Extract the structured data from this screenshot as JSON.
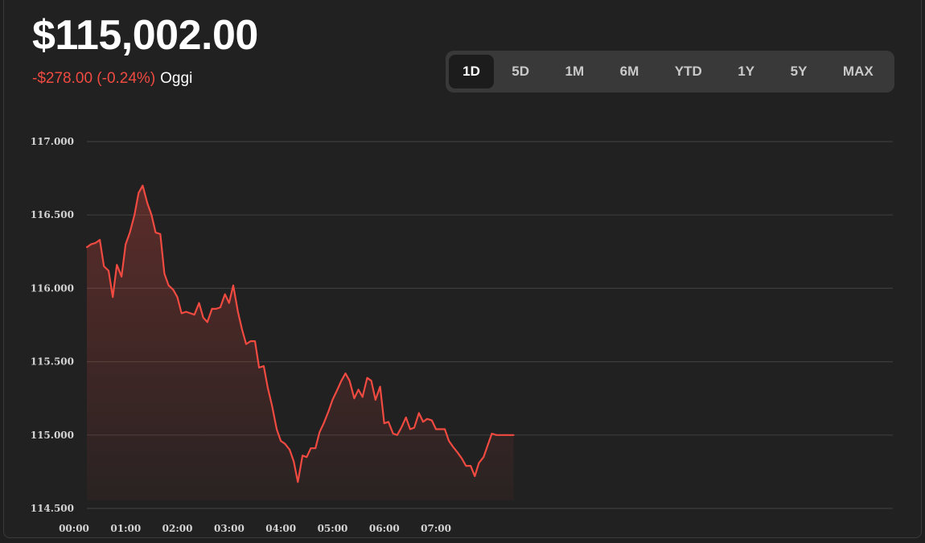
{
  "header": {
    "price": "$115,002.00",
    "change": "-$278.00 (-0.24%)",
    "period_label": "Oggi"
  },
  "range_selector": {
    "options": [
      "1D",
      "5D",
      "1M",
      "6M",
      "YTD",
      "1Y",
      "5Y",
      "MAX"
    ],
    "active": "1D"
  },
  "colors": {
    "line": "#f04a41",
    "negative_text": "#f04a41",
    "background": "#212121",
    "grid": "#3c3c3c",
    "active_tab": "#1c1c1c",
    "tab_bar": "#393939"
  },
  "chart_data": {
    "type": "area",
    "title": "",
    "xlabel": "",
    "ylabel": "",
    "x_ticks": [
      "00:00",
      "01:00",
      "02:00",
      "03:00",
      "04:00",
      "05:00",
      "06:00",
      "07:00"
    ],
    "y_ticks": [
      "117.000",
      "116.500",
      "116.000",
      "115.500",
      "115.000",
      "114.500"
    ],
    "y_tick_values": [
      117000,
      116500,
      116000,
      115500,
      115000,
      114500
    ],
    "ylim": [
      114500,
      117000
    ],
    "xlim_hours": [
      0,
      16
    ],
    "grid": true,
    "series": [
      {
        "x": [
          0.0,
          0.08,
          0.17,
          0.25,
          0.33,
          0.42,
          0.5,
          0.58,
          0.67,
          0.75,
          0.83,
          0.92,
          1.0,
          1.08,
          1.17,
          1.25,
          1.33,
          1.42,
          1.5,
          1.58,
          1.67,
          1.75,
          1.83,
          1.92,
          2.0,
          2.08,
          2.17,
          2.25,
          2.33,
          2.42,
          2.5,
          2.58,
          2.67,
          2.75,
          2.83,
          2.92,
          3.0,
          3.08,
          3.17,
          3.25,
          3.33,
          3.42,
          3.5,
          3.58,
          3.67,
          3.75,
          3.83,
          3.92,
          4.0,
          4.08,
          4.17,
          4.25,
          4.33,
          4.42,
          4.5,
          4.58,
          4.67,
          4.75,
          4.83,
          4.92,
          5.0,
          5.08,
          5.17,
          5.25,
          5.33,
          5.42,
          5.5,
          5.58,
          5.67,
          5.75,
          5.83,
          5.92,
          6.0,
          6.08,
          6.17,
          6.25,
          6.33,
          6.42,
          6.5,
          6.58,
          6.67,
          6.75,
          6.83,
          6.92,
          7.0,
          7.08,
          7.17,
          7.25,
          7.33,
          7.42,
          7.5,
          7.58,
          7.67,
          7.75,
          7.83,
          7.92,
          8.0,
          8.08,
          8.17,
          8.25
        ],
        "y": [
          116280,
          116300,
          116310,
          116330,
          116150,
          116120,
          115940,
          116160,
          116080,
          116300,
          116380,
          116500,
          116650,
          116700,
          116580,
          116500,
          116380,
          116370,
          116100,
          116020,
          115990,
          115940,
          115830,
          115840,
          115830,
          115820,
          115900,
          115800,
          115770,
          115860,
          115860,
          115870,
          115960,
          115900,
          116020,
          115840,
          115720,
          115620,
          115640,
          115640,
          115460,
          115470,
          115320,
          115200,
          115040,
          114960,
          114940,
          114900,
          114820,
          114680,
          114860,
          114850,
          114910,
          114910,
          115020,
          115080,
          115160,
          115240,
          115300,
          115370,
          115420,
          115370,
          115250,
          115310,
          115260,
          115390,
          115370,
          115240,
          115330,
          115080,
          115090,
          115010,
          115000,
          115050,
          115120,
          115040,
          115050,
          115150,
          115090,
          115110,
          115100,
          115040,
          115040,
          115040,
          114960,
          114920,
          114880,
          114840,
          114790,
          114790,
          114720,
          114810,
          114850,
          114930,
          115010,
          115000,
          115000,
          115000,
          115000,
          115000
        ]
      }
    ]
  }
}
